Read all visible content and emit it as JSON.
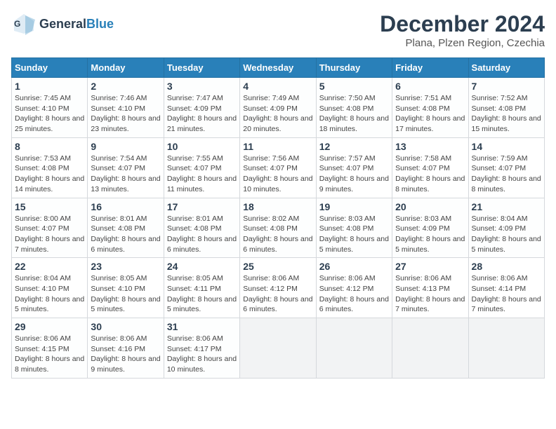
{
  "header": {
    "logo_general": "General",
    "logo_blue": "Blue",
    "title": "December 2024",
    "subtitle": "Plana, Plzen Region, Czechia"
  },
  "days_of_week": [
    "Sunday",
    "Monday",
    "Tuesday",
    "Wednesday",
    "Thursday",
    "Friday",
    "Saturday"
  ],
  "weeks": [
    [
      {
        "day": "1",
        "info": "Sunrise: 7:45 AM\nSunset: 4:10 PM\nDaylight: 8 hours and 25 minutes."
      },
      {
        "day": "2",
        "info": "Sunrise: 7:46 AM\nSunset: 4:10 PM\nDaylight: 8 hours and 23 minutes."
      },
      {
        "day": "3",
        "info": "Sunrise: 7:47 AM\nSunset: 4:09 PM\nDaylight: 8 hours and 21 minutes."
      },
      {
        "day": "4",
        "info": "Sunrise: 7:49 AM\nSunset: 4:09 PM\nDaylight: 8 hours and 20 minutes."
      },
      {
        "day": "5",
        "info": "Sunrise: 7:50 AM\nSunset: 4:08 PM\nDaylight: 8 hours and 18 minutes."
      },
      {
        "day": "6",
        "info": "Sunrise: 7:51 AM\nSunset: 4:08 PM\nDaylight: 8 hours and 17 minutes."
      },
      {
        "day": "7",
        "info": "Sunrise: 7:52 AM\nSunset: 4:08 PM\nDaylight: 8 hours and 15 minutes."
      }
    ],
    [
      {
        "day": "8",
        "info": "Sunrise: 7:53 AM\nSunset: 4:08 PM\nDaylight: 8 hours and 14 minutes."
      },
      {
        "day": "9",
        "info": "Sunrise: 7:54 AM\nSunset: 4:07 PM\nDaylight: 8 hours and 13 minutes."
      },
      {
        "day": "10",
        "info": "Sunrise: 7:55 AM\nSunset: 4:07 PM\nDaylight: 8 hours and 11 minutes."
      },
      {
        "day": "11",
        "info": "Sunrise: 7:56 AM\nSunset: 4:07 PM\nDaylight: 8 hours and 10 minutes."
      },
      {
        "day": "12",
        "info": "Sunrise: 7:57 AM\nSunset: 4:07 PM\nDaylight: 8 hours and 9 minutes."
      },
      {
        "day": "13",
        "info": "Sunrise: 7:58 AM\nSunset: 4:07 PM\nDaylight: 8 hours and 8 minutes."
      },
      {
        "day": "14",
        "info": "Sunrise: 7:59 AM\nSunset: 4:07 PM\nDaylight: 8 hours and 8 minutes."
      }
    ],
    [
      {
        "day": "15",
        "info": "Sunrise: 8:00 AM\nSunset: 4:07 PM\nDaylight: 8 hours and 7 minutes."
      },
      {
        "day": "16",
        "info": "Sunrise: 8:01 AM\nSunset: 4:08 PM\nDaylight: 8 hours and 6 minutes."
      },
      {
        "day": "17",
        "info": "Sunrise: 8:01 AM\nSunset: 4:08 PM\nDaylight: 8 hours and 6 minutes."
      },
      {
        "day": "18",
        "info": "Sunrise: 8:02 AM\nSunset: 4:08 PM\nDaylight: 8 hours and 6 minutes."
      },
      {
        "day": "19",
        "info": "Sunrise: 8:03 AM\nSunset: 4:08 PM\nDaylight: 8 hours and 5 minutes."
      },
      {
        "day": "20",
        "info": "Sunrise: 8:03 AM\nSunset: 4:09 PM\nDaylight: 8 hours and 5 minutes."
      },
      {
        "day": "21",
        "info": "Sunrise: 8:04 AM\nSunset: 4:09 PM\nDaylight: 8 hours and 5 minutes."
      }
    ],
    [
      {
        "day": "22",
        "info": "Sunrise: 8:04 AM\nSunset: 4:10 PM\nDaylight: 8 hours and 5 minutes."
      },
      {
        "day": "23",
        "info": "Sunrise: 8:05 AM\nSunset: 4:10 PM\nDaylight: 8 hours and 5 minutes."
      },
      {
        "day": "24",
        "info": "Sunrise: 8:05 AM\nSunset: 4:11 PM\nDaylight: 8 hours and 5 minutes."
      },
      {
        "day": "25",
        "info": "Sunrise: 8:06 AM\nSunset: 4:12 PM\nDaylight: 8 hours and 6 minutes."
      },
      {
        "day": "26",
        "info": "Sunrise: 8:06 AM\nSunset: 4:12 PM\nDaylight: 8 hours and 6 minutes."
      },
      {
        "day": "27",
        "info": "Sunrise: 8:06 AM\nSunset: 4:13 PM\nDaylight: 8 hours and 7 minutes."
      },
      {
        "day": "28",
        "info": "Sunrise: 8:06 AM\nSunset: 4:14 PM\nDaylight: 8 hours and 7 minutes."
      }
    ],
    [
      {
        "day": "29",
        "info": "Sunrise: 8:06 AM\nSunset: 4:15 PM\nDaylight: 8 hours and 8 minutes."
      },
      {
        "day": "30",
        "info": "Sunrise: 8:06 AM\nSunset: 4:16 PM\nDaylight: 8 hours and 9 minutes."
      },
      {
        "day": "31",
        "info": "Sunrise: 8:06 AM\nSunset: 4:17 PM\nDaylight: 8 hours and 10 minutes."
      },
      null,
      null,
      null,
      null
    ]
  ]
}
